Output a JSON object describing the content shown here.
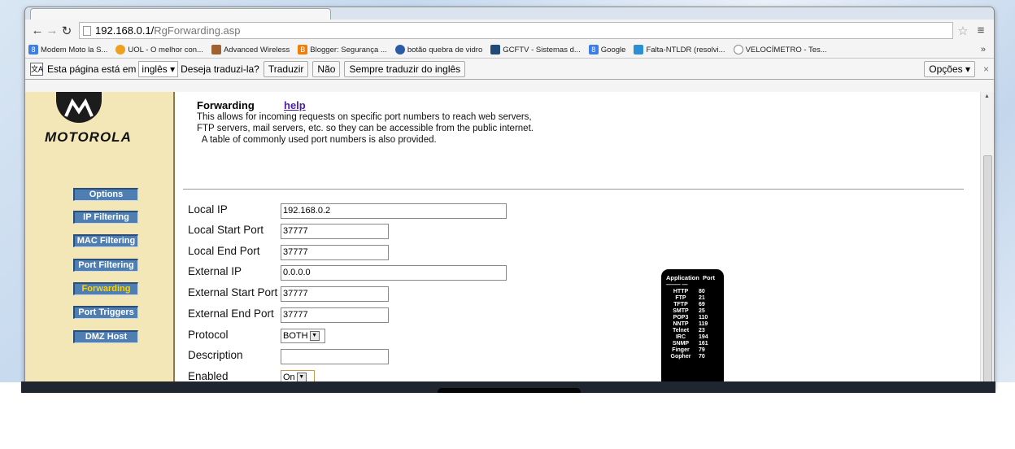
{
  "browser": {
    "url_host": "192.168.0.1/",
    "url_path": "RgForwarding.asp",
    "bookmarks": [
      "Modem Moto  la S...",
      "UOL - O melhor con...",
      "Advanced Wireless",
      "Blogger: Segurança ...",
      "botão quebra de vidro",
      "GCFTV - Sistemas d...",
      "Google",
      "Falta-NTLDR (resolvi...",
      "VELOCÍMETRO - Tes..."
    ],
    "bookmarks_more": "»"
  },
  "translate": {
    "prefix": "Esta página está em",
    "language": "inglês",
    "question": "Deseja traduzi-la?",
    "translate_btn": "Traduzir",
    "no_btn": "Não",
    "always_btn": "Sempre traduzir do inglês",
    "options_btn": "Opções"
  },
  "sidebar": {
    "brand": "MOTOROLA",
    "items": [
      "Options",
      "IP Filtering",
      "MAC Filtering",
      "Port Filtering",
      "Forwarding",
      "Port Triggers",
      "DMZ Host"
    ],
    "active": "Forwarding",
    "active_color": "#ffd400"
  },
  "page": {
    "title": "Forwarding",
    "help": "help",
    "desc": [
      "This allows for incoming requests on specific port numbers to reach  web servers,",
      "FTP servers, mail servers, etc. so they can be accessible from the public internet.",
      "  A table of commonly used port numbers is also provided."
    ]
  },
  "form": {
    "local_ip_label": "Local IP",
    "local_ip": "192.168.0.2",
    "local_start_label": "Local Start Port",
    "local_start": "37777",
    "local_end_label": "Local End Port",
    "local_end": "37777",
    "external_ip_label": "External IP",
    "external_ip": "0.0.0.0",
    "ext_start_label": "External Start Port",
    "ext_start": "37777",
    "ext_end_label": "External End Port",
    "ext_end": "37777",
    "protocol_label": "Protocol",
    "protocol": "BOTH",
    "description_label": "Description",
    "description": "",
    "enabled_label": "Enabled",
    "enabled": "On"
  },
  "port_table": {
    "header_app": "Application",
    "header_port": "Port",
    "dashes_app": "---------------",
    "dashes_port": "------",
    "rows": [
      [
        "HTTP",
        "80"
      ],
      [
        "FTP",
        "21"
      ],
      [
        "TFTP",
        "69"
      ],
      [
        "SMTP",
        "25"
      ],
      [
        "POP3",
        "110"
      ],
      [
        "NNTP",
        "119"
      ],
      [
        "Telnet",
        "23"
      ],
      [
        "IRC",
        "194"
      ],
      [
        "SNMP",
        "161"
      ],
      [
        "Finger",
        "79"
      ],
      [
        "Gopher",
        "70"
      ]
    ]
  }
}
